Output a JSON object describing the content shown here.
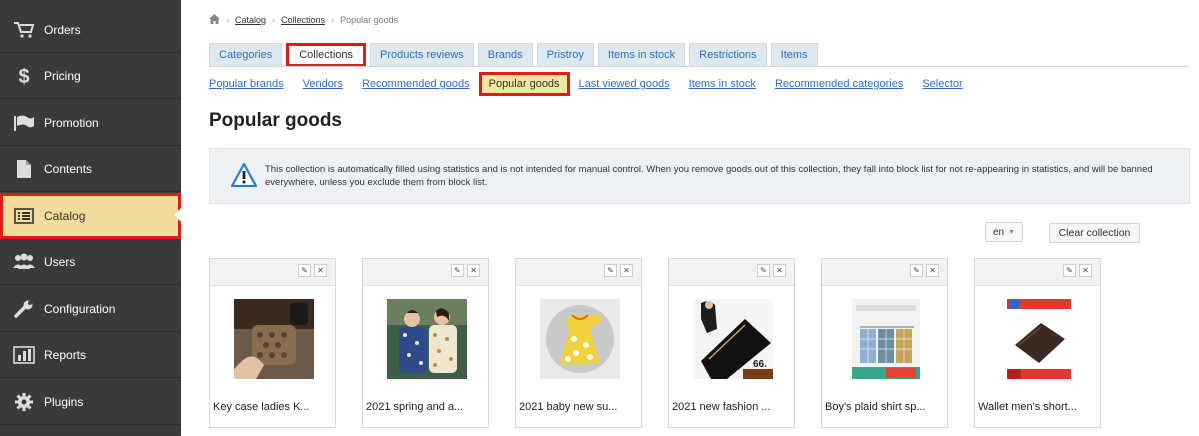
{
  "sidebar": {
    "items": [
      {
        "label": "Orders",
        "icon": "cart-icon"
      },
      {
        "label": "Pricing",
        "icon": "dollar-icon"
      },
      {
        "label": "Promotion",
        "icon": "flag-icon"
      },
      {
        "label": "Contents",
        "icon": "document-icon"
      },
      {
        "label": "Catalog",
        "icon": "list-icon",
        "active": true
      },
      {
        "label": "Users",
        "icon": "users-icon"
      },
      {
        "label": "Configuration",
        "icon": "wrench-icon"
      },
      {
        "label": "Reports",
        "icon": "bar-chart-icon"
      },
      {
        "label": "Plugins",
        "icon": "gear-icon"
      }
    ]
  },
  "breadcrumb": {
    "home_icon": "home-icon",
    "items": [
      "Catalog",
      "Collections",
      "Popular goods"
    ]
  },
  "tabs": {
    "items": [
      "Categories",
      "Collections",
      "Products reviews",
      "Brands",
      "Pristroy",
      "Items in stock",
      "Restrictions",
      "Items"
    ],
    "active": "Collections"
  },
  "subtabs": {
    "items": [
      "Popular brands",
      "Vendors",
      "Recommended goods",
      "Popular goods",
      "Last viewed goods",
      "Items in stock",
      "Recommended categories",
      "Selector"
    ],
    "active": "Popular goods"
  },
  "page": {
    "title": "Popular goods",
    "notice": "This collection is automatically filled using statistics and is not intended for manual control. When you remove goods out of this collection, they fall into block list for not re-appearing in statistics, and will be banned everywhere, unless you exclude them from block list."
  },
  "controls": {
    "language": "en",
    "clear_label": "Clear collection"
  },
  "products": [
    {
      "name": "Key case ladies K...",
      "image": "key-case-product-image"
    },
    {
      "name": "2021 spring and a...",
      "image": "kids-pajamas-product-image"
    },
    {
      "name": "2021 baby new su...",
      "image": "baby-dress-product-image"
    },
    {
      "name": "2021 new fashion ...",
      "image": "black-wallet-product-image"
    },
    {
      "name": "Boy's plaid shirt sp...",
      "image": "plaid-shirts-product-image"
    },
    {
      "name": "Wallet men's short...",
      "image": "mens-wallet-product-image"
    }
  ],
  "colors": {
    "sidebar_bg": "#3a3a3a",
    "active_highlight": "#f3dd9a",
    "link": "#2a6ec8",
    "callout_outline": "#e01b1b"
  }
}
